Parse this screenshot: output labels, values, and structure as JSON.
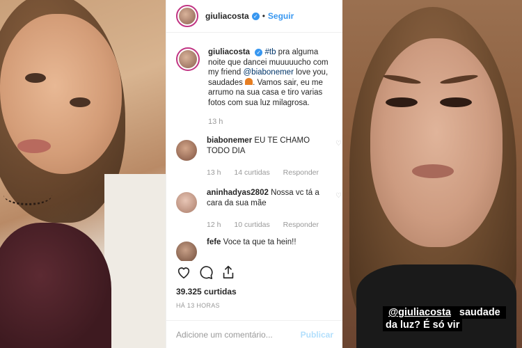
{
  "post": {
    "username": "giuliacosta",
    "follow_label": "Seguir",
    "caption_user": "giuliacosta",
    "caption_tag1": "#tb",
    "caption_part1": " pra alguma noite que dancei muuuuucho com my friend ",
    "caption_mention": "@biabonemer",
    "caption_part2": " love you, saudades ",
    "caption_part3": ". Vamos sair, eu me arrumo na sua casa e tiro varias fotos com sua luz milagrosa.",
    "caption_time": "13 h",
    "comments": [
      {
        "user": "biabonemer",
        "text": "EU TE CHAMO TODO DIA",
        "time": "13 h",
        "likes": "14 curtidas",
        "reply": "Responder"
      },
      {
        "user": "aninhadyas2802",
        "text": "Nossa vc tá a cara da sua mãe",
        "time": "12 h",
        "likes": "10 curtidas",
        "reply": "Responder"
      },
      {
        "user": "fefe",
        "text": "Voce ta que ta hein!!"
      }
    ],
    "likes_count": "39.325 curtidas",
    "posted_when": "HÁ 13 HORAS",
    "add_comment_placeholder": "Adicione um comentário...",
    "publish_label": "Publicar"
  },
  "story": {
    "mention": "@giuliacosta",
    "line1_rest": " saudade",
    "line2": "da luz? É só vir"
  },
  "icons": {
    "heart": "heart-icon",
    "comment": "comment-icon",
    "share": "share-icon",
    "verified": "verified-badge-icon"
  },
  "colors": {
    "link": "#3897f0",
    "mention": "#003569",
    "story_ring": "#c13584"
  }
}
